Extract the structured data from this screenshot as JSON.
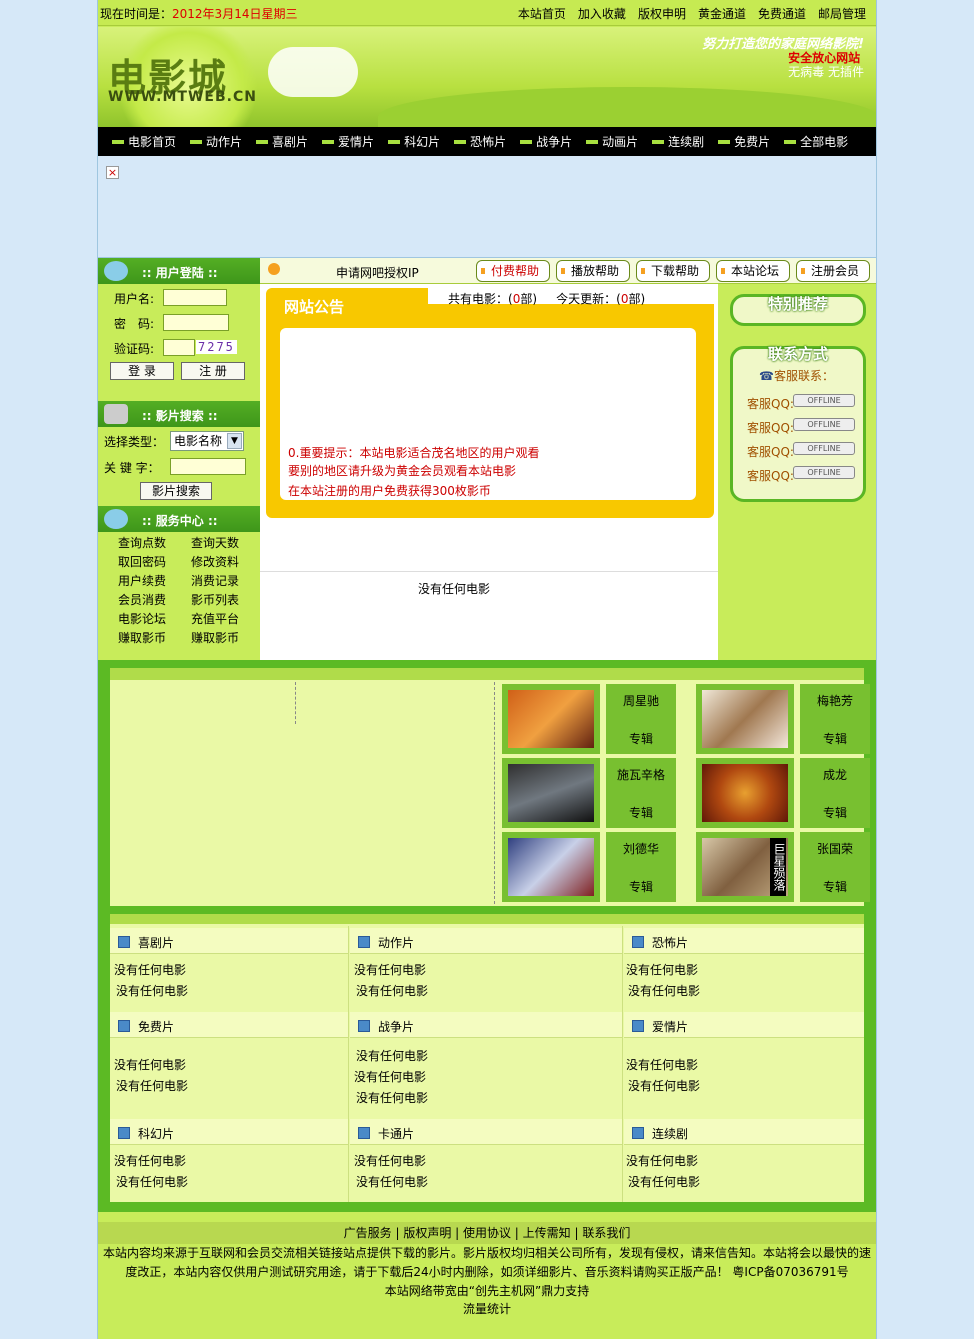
{
  "topbar": {
    "time_label": "现在时间是：",
    "time_value": "2012年3月14日星期三",
    "links": [
      "本站首页",
      "加入收藏",
      "版权申明",
      "黄金通道",
      "免费通道",
      "邮局管理"
    ]
  },
  "banner": {
    "logo_text": "电影城",
    "logo_url": "WWW.MTWEB.CN",
    "slogan": "努力打造您的家庭网络影院!",
    "safe_line1": "安全放心网站",
    "safe_line2": "无病毒 无插件"
  },
  "nav": [
    "电影首页",
    "动作片",
    "喜剧片",
    "爱情片",
    "科幻片",
    "恐怖片",
    "战争片",
    "动画片",
    "连续剧",
    "免费片",
    "全部电影"
  ],
  "login": {
    "title": ":: 用户登陆 ::",
    "username_label": "用户名:",
    "password_label": "密　码:",
    "captcha_label": "验证码:",
    "captcha_value": "7275",
    "login_button": "登 录",
    "register_button": "注 册"
  },
  "search": {
    "title": ":: 影片搜索 ::",
    "type_label": "选择类型：",
    "type_value": "电影名称",
    "keyword_label": "关 键 字：",
    "button": "影片搜索"
  },
  "service": {
    "title": ":: 服务中心 ::",
    "items": [
      "查询点数",
      "查询天数",
      "取回密码",
      "修改资料",
      "用户续费",
      "消费记录",
      "会员消费",
      "影币列表",
      "电影论坛",
      "充值平台",
      "赚取影币",
      "赚取影币"
    ]
  },
  "helpbar": {
    "title": "申请网吧授权IP",
    "buttons": [
      "付费帮助",
      "播放帮助",
      "下载帮助",
      "本站论坛",
      "注册会员"
    ]
  },
  "notice": {
    "title": "网站公告",
    "stats_label1": "共有电影：",
    "stats_value1": "0",
    "stats_unit1": "部)",
    "stats_label2": "今天更新：",
    "stats_value2": "0",
    "stats_unit2": "部)",
    "lines": [
      "0.重要提示：本站电影适合茂名地区的用户观看",
      "要别的地区请升级为黄金会员观看本站电影",
      "在本站注册的用户免费获得300枚影币"
    ],
    "empty": "没有任何电影"
  },
  "recommend": {
    "title": "特别推荐"
  },
  "contact": {
    "title": "联系方式",
    "service_label": "客服联系：",
    "qq_label": "客服QQ:",
    "qq_status": "OFFLINE"
  },
  "stars": [
    {
      "name": "周星驰",
      "tag": "专辑"
    },
    {
      "name": "梅艳芳",
      "tag": "专辑"
    },
    {
      "name": "施瓦辛格",
      "tag": "专辑"
    },
    {
      "name": "成龙",
      "tag": "专辑"
    },
    {
      "name": "刘德华",
      "tag": "专辑"
    },
    {
      "name": "张国荣",
      "tag": "专辑"
    }
  ],
  "star_caption": "巨星殒落",
  "categories": [
    {
      "name": "喜剧片"
    },
    {
      "name": "动作片"
    },
    {
      "name": "恐怖片"
    },
    {
      "name": "免费片"
    },
    {
      "name": "战争片"
    },
    {
      "name": "爱情片"
    },
    {
      "name": "科幻片"
    },
    {
      "name": "卡通片"
    },
    {
      "name": "连续剧"
    }
  ],
  "empty_text": "没有任何电影",
  "footer": {
    "links": "广告服务 | 版权声明 | 使用协议 | 上传需知 | 联系我们",
    "line1": "本站内容均来源于互联网和会员交流相关链接站点提供下载的影片。影片版权均归相关公司所有，发现有侵权，请来信告知。本站将会以最快的速",
    "line2": "度改正，本站内容仅供用户测试研究用途，请于下载后24小时内删除，如须详细影片、音乐资料请购买正版产品！ 粤ICP备07036791号",
    "line3": "本站网络带宽由“创先主机网”鼎力支持",
    "line4": "流量统计"
  },
  "colors": {
    "accent_red": "#cc0000",
    "bg_green": "#c8ec5a",
    "dark_green": "#5cba24"
  }
}
